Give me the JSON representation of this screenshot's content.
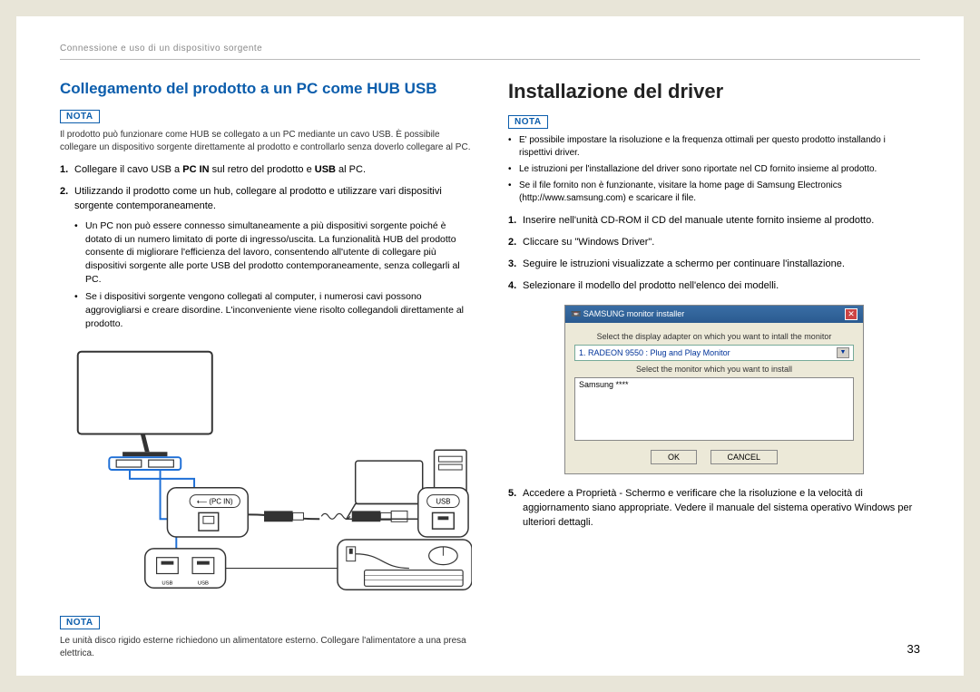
{
  "header": "Connessione e uso di un dispositivo sorgente",
  "page_number": "33",
  "left": {
    "title": "Collegamento del prodotto a un PC come HUB USB",
    "nota_label": "NOTA",
    "intro": "Il prodotto può funzionare come HUB se collegato a un PC mediante un cavo USB. È possibile collegare un dispositivo sorgente direttamente al prodotto e controllarlo senza doverlo collegare al PC.",
    "steps": [
      {
        "num": "1.",
        "html": "Collegare il cavo USB a <b>PC IN</b> sul retro del prodotto e <b>USB</b> al PC."
      },
      {
        "num": "2.",
        "text": "Utilizzando il prodotto come un hub, collegare al prodotto e utilizzare vari dispositivi sorgente contemporaneamente.",
        "bullets": [
          "Un PC non può essere connesso simultaneamente a più dispositivi sorgente poiché è dotato di un numero limitato di porte di ingresso/uscita. La funzionalità HUB del prodotto consente di migliorare l'efficienza del lavoro, consentendo all'utente di collegare più dispositivi sorgente alle porte USB del prodotto contemporaneamente, senza collegarli al PC.",
          "Se i dispositivi sorgente vengono collegati al computer, i numerosi cavi possono aggrovigliarsi e creare disordine. L'inconveniente viene risolto collegandoli direttamente al prodotto."
        ]
      }
    ],
    "diagram_labels": {
      "pcin": "(PC IN)",
      "usb": "USB",
      "usb_small": "USB"
    },
    "footer_nota_label": "NOTA",
    "footer_note": "Le unità disco rigido esterne richiedono un alimentatore esterno. Collegare l'alimentatore a una presa elettrica."
  },
  "right": {
    "title": "Installazione del driver",
    "nota_label": "NOTA",
    "notes": [
      "E' possibile impostare la risoluzione e la frequenza ottimali per questo prodotto installando i rispettivi driver.",
      "Le istruzioni per l'installazione del driver sono riportate nel CD fornito insieme al prodotto.",
      "Se il file fornito non è funzionante, visitare la home page di Samsung Electronics (http://www.samsung.com) e scaricare il file."
    ],
    "steps": [
      {
        "num": "1.",
        "text": "Inserire nell'unità CD-ROM il CD del manuale utente fornito insieme al prodotto."
      },
      {
        "num": "2.",
        "text": "Cliccare su \"Windows Driver\"."
      },
      {
        "num": "3.",
        "text": "Seguire le istruzioni visualizzate a schermo per continuare l'installazione."
      },
      {
        "num": "4.",
        "text": "Selezionare il modello del prodotto nell'elenco dei modelli."
      }
    ],
    "installer": {
      "title": "SAMSUNG monitor installer",
      "line1": "Select the display adapter on which you want to intall the monitor",
      "dropdown": "1. RADEON 9550 : Plug and Play Monitor",
      "line2": "Select the monitor which you want to install",
      "list_item": "Samsung ****",
      "ok": "OK",
      "cancel": "CANCEL"
    },
    "step5": {
      "num": "5.",
      "text": "Accedere a Proprietà - Schermo e verificare che la risoluzione e la velocità di aggiornamento siano appropriate. Vedere il manuale del sistema operativo Windows per ulteriori dettagli."
    }
  }
}
